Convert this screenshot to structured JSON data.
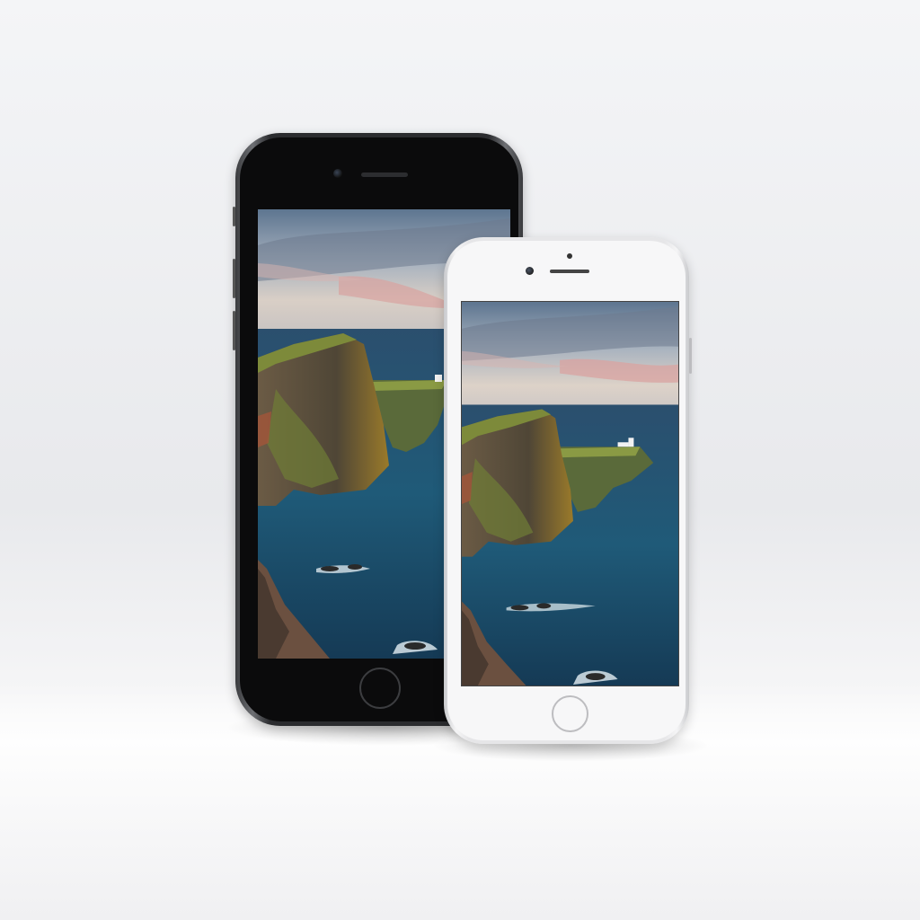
{
  "scene": {
    "devices": [
      {
        "finish": "space-gray",
        "wallpaper": "sea-cliff-lighthouse"
      },
      {
        "finish": "silver",
        "wallpaper": "sea-cliff-lighthouse"
      }
    ],
    "colors": {
      "background": "#eceef1",
      "sky_top": "#5d7590",
      "sky_pink": "#d9a3a0",
      "sea": "#1f4d6b",
      "cliff": "#5a5040",
      "grass": "#7a8a3a"
    }
  }
}
